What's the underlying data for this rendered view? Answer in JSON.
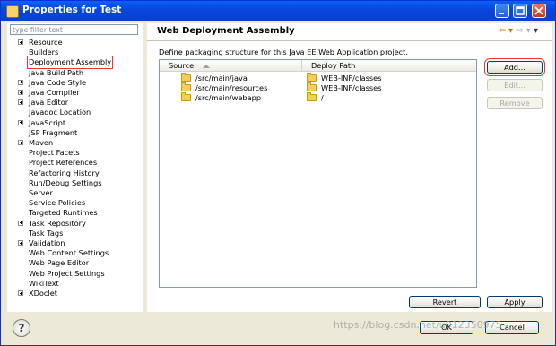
{
  "window": {
    "title": "Properties for Test"
  },
  "filter": {
    "placeholder": "type filter text"
  },
  "tree": [
    {
      "label": "Resource",
      "expandable": true
    },
    {
      "label": "Builders",
      "expandable": false
    },
    {
      "label": "Deployment Assembly",
      "expandable": false,
      "selected": true
    },
    {
      "label": "Java Build Path",
      "expandable": false
    },
    {
      "label": "Java Code Style",
      "expandable": true
    },
    {
      "label": "Java Compiler",
      "expandable": true
    },
    {
      "label": "Java Editor",
      "expandable": true
    },
    {
      "label": "Javadoc Location",
      "expandable": false
    },
    {
      "label": "JavaScript",
      "expandable": true
    },
    {
      "label": "JSP Fragment",
      "expandable": false
    },
    {
      "label": "Maven",
      "expandable": true
    },
    {
      "label": "Project Facets",
      "expandable": false
    },
    {
      "label": "Project References",
      "expandable": false
    },
    {
      "label": "Refactoring History",
      "expandable": false
    },
    {
      "label": "Run/Debug Settings",
      "expandable": false
    },
    {
      "label": "Server",
      "expandable": false
    },
    {
      "label": "Service Policies",
      "expandable": false
    },
    {
      "label": "Targeted Runtimes",
      "expandable": false
    },
    {
      "label": "Task Repository",
      "expandable": true
    },
    {
      "label": "Task Tags",
      "expandable": false
    },
    {
      "label": "Validation",
      "expandable": true
    },
    {
      "label": "Web Content Settings",
      "expandable": false
    },
    {
      "label": "Web Page Editor",
      "expandable": false
    },
    {
      "label": "Web Project Settings",
      "expandable": false
    },
    {
      "label": "WikiText",
      "expandable": false
    },
    {
      "label": "XDoclet",
      "expandable": true
    }
  ],
  "page": {
    "title": "Web Deployment Assembly",
    "description": "Define packaging structure for this Java EE Web Application project.",
    "columns": {
      "source": "Source",
      "deploy": "Deploy Path"
    },
    "rows": [
      {
        "source": "/src/main/java",
        "deploy": "WEB-INF/classes"
      },
      {
        "source": "/src/main/resources",
        "deploy": "WEB-INF/classes"
      },
      {
        "source": "/src/main/webapp",
        "deploy": "/"
      }
    ],
    "buttons": {
      "add": "Add...",
      "edit": "Edit...",
      "remove": "Remove",
      "revert": "Revert",
      "apply": "Apply"
    }
  },
  "dialog": {
    "ok": "OK",
    "cancel": "Cancel",
    "help": "?"
  },
  "watermark": "https://blog.csdn.net/u012350975",
  "colors": {
    "title_bar": "#0a4fe6",
    "highlight": "#e33333",
    "folder": "#f3cf5a"
  }
}
